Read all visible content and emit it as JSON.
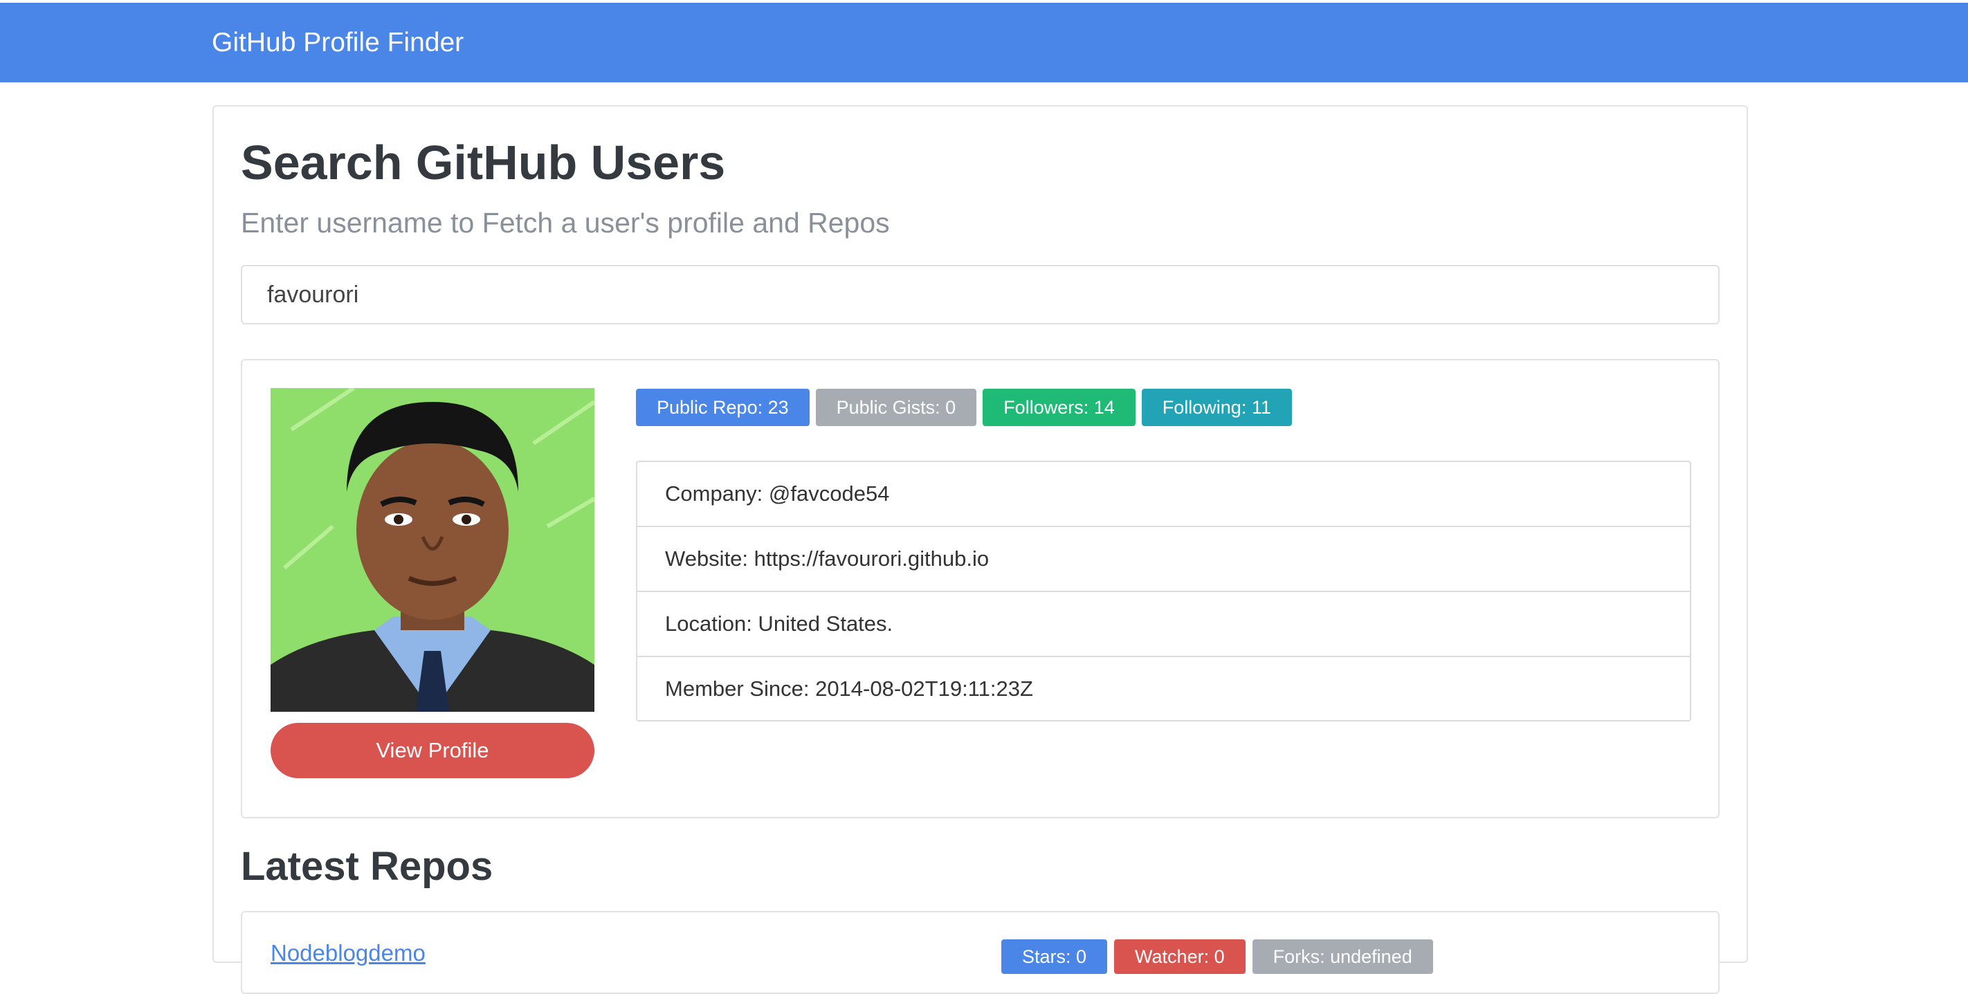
{
  "navbar": {
    "brand": "GitHub Profile Finder"
  },
  "search": {
    "title": "Search GitHub Users",
    "subtitle": "Enter username to Fetch a user's profile and Repos",
    "value": "favourori"
  },
  "profile": {
    "view_button": "View Profile",
    "badges": [
      {
        "label": "Public Repo: 23",
        "color": "#4a86e8"
      },
      {
        "label": "Public Gists: 0",
        "color": "#a6acb2"
      },
      {
        "label": "Followers: 14",
        "color": "#1fbb76"
      },
      {
        "label": "Following: 11",
        "color": "#22a4b6"
      }
    ],
    "details": [
      "Company: @favcode54",
      "Website: https://favourori.github.io",
      "Location: United States.",
      "Member Since: 2014-08-02T19:11:23Z"
    ]
  },
  "repos": {
    "title": "Latest Repos",
    "items": [
      {
        "name": "Nodeblogdemo",
        "stars": "Stars: 0",
        "watchers": "Watcher: 0",
        "forks": "Forks: undefined"
      }
    ]
  }
}
